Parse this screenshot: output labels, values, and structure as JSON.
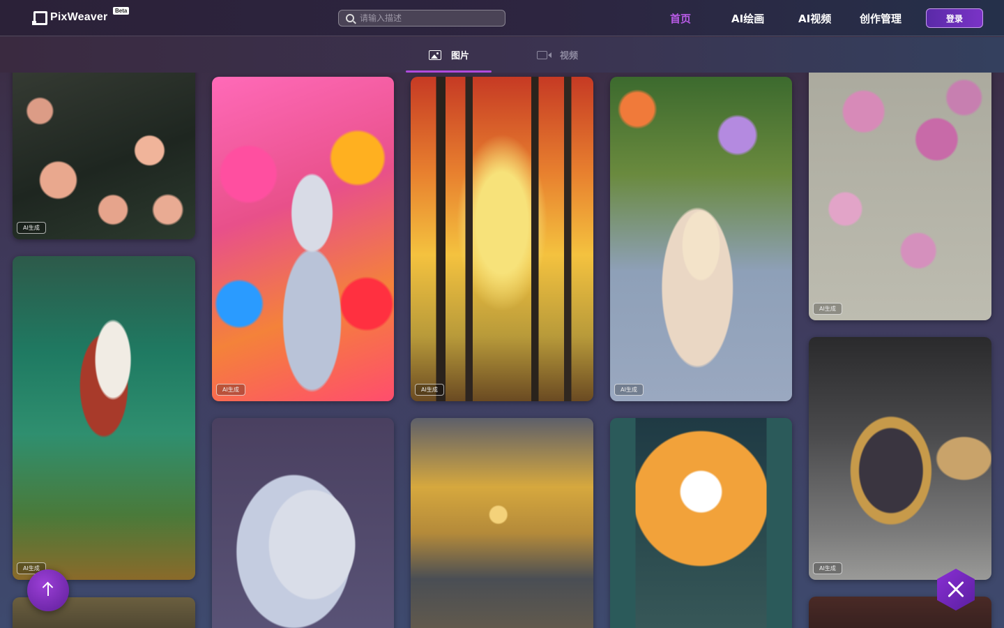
{
  "header": {
    "logo_text": "PixWeaver",
    "beta_label": "Beta",
    "search": {
      "placeholder": "请输入描述",
      "value": ""
    },
    "nav": [
      {
        "label": "首页",
        "active": true
      },
      {
        "label": "AI绘画",
        "active": false
      },
      {
        "label": "AI视频",
        "active": false
      },
      {
        "label": "创作管理",
        "active": false
      }
    ],
    "login_label": "登录"
  },
  "tabs": [
    {
      "label": "图片",
      "icon": "image-icon",
      "active": true
    },
    {
      "label": "视频",
      "icon": "video-icon",
      "active": false
    }
  ],
  "gallery": {
    "badge_label": "AI生成",
    "items": [
      {
        "name": "floral-tiger"
      },
      {
        "name": "boat-on-water"
      },
      {
        "name": "dark-landscape"
      },
      {
        "name": "colorful-woman-portrait"
      },
      {
        "name": "white-cat"
      },
      {
        "name": "autumn-forest"
      },
      {
        "name": "sunset-lake-house"
      },
      {
        "name": "teacup-love"
      },
      {
        "name": "moon-mountains-pagoda"
      },
      {
        "name": "pink-blossom-embroidery"
      },
      {
        "name": "ornate-golden-vase"
      },
      {
        "name": "partial-bottom-image"
      }
    ]
  },
  "floating": {
    "back_to_top_icon": "arrow-up-icon",
    "create_icon": "tools-icon"
  },
  "colors": {
    "accent": "#b85be6",
    "login_bg": "#6a2cb8",
    "tab_underline": "#b04bdc"
  }
}
